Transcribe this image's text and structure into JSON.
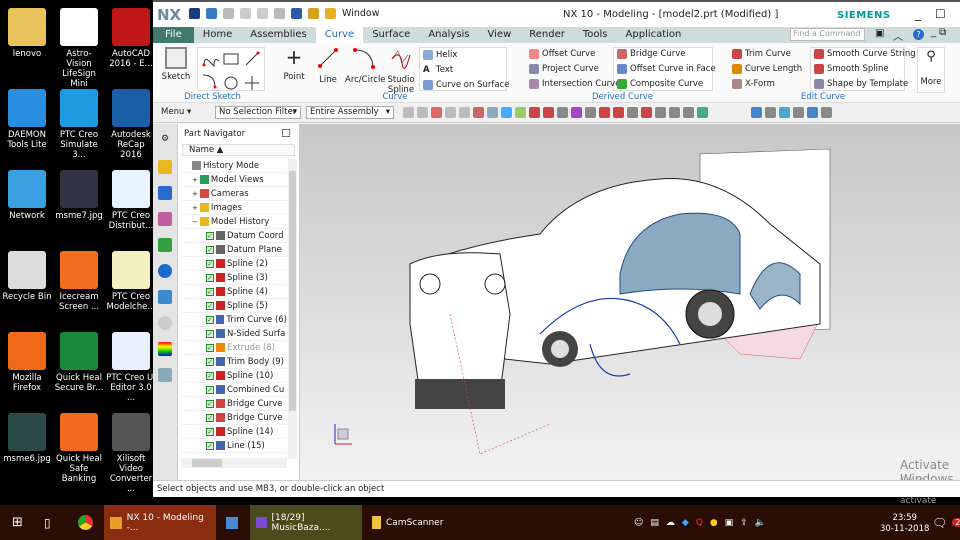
{
  "desktop": {
    "icons": [
      {
        "label": "lenovo",
        "color": "#e8c25a"
      },
      {
        "label": "Astro-Vision LifeSign Mini",
        "color": "#fff"
      },
      {
        "label": "AutoCAD 2016 - E...",
        "color": "#c01818"
      },
      {
        "label": "DAEMON Tools Lite",
        "color": "#2a8ee0"
      },
      {
        "label": "PTC Creo Simulate 3...",
        "color": "#1d9be0"
      },
      {
        "label": "Autodesk ReCap 2016",
        "color": "#1b5ea8"
      },
      {
        "label": "Network",
        "color": "#3aa0e0"
      },
      {
        "label": "msme7.jpg",
        "color": "#334"
      },
      {
        "label": "PTC Creo Distribut...",
        "color": "#e8f4ff"
      },
      {
        "label": "Recycle Bin",
        "color": "#ddd"
      },
      {
        "label": "Icecream Screen ...",
        "color": "#f07020"
      },
      {
        "label": "PTC Creo Modelche...",
        "color": "#f5f0c0"
      },
      {
        "label": "Mozilla Firefox",
        "color": "#f06a1a"
      },
      {
        "label": "Quick Heal Secure Br...",
        "color": "#1a8a3a"
      },
      {
        "label": "PTC Creo UI Editor 3.0 ...",
        "color": "#e8f0ff"
      },
      {
        "label": "msme6.jpg",
        "color": "#2a4a4a"
      },
      {
        "label": "Quick Heal Safe Banking",
        "color": "#f06a20"
      },
      {
        "label": "Xilisoft Video Converter ...",
        "color": "#555"
      }
    ]
  },
  "window": {
    "logo": "NX",
    "quick_access_menu": "Window",
    "title": "NX 10 - Modeling - [model2.prt (Modified) ]",
    "brand": "SIEMENS",
    "brand_color": "#009999"
  },
  "tabs": [
    "File",
    "Home",
    "Assemblies",
    "Curve",
    "Surface",
    "Analysis",
    "View",
    "Render",
    "Tools",
    "Application"
  ],
  "active_tab": "Curve",
  "find_placeholder": "Find a Command",
  "ribbon": {
    "direct_sketch": {
      "label": "Direct Sketch",
      "sketch": "Sketch"
    },
    "curve": {
      "label": "Curve",
      "point": "Point",
      "line": "Line",
      "arc": "Arc/Circle",
      "studio": "Studio Spline",
      "helix": "Helix",
      "text": "Text",
      "cos": "Curve on Surface"
    },
    "derived": {
      "label": "Derived Curve",
      "items": [
        "Offset Curve",
        "Project Curve",
        "Intersection Curve",
        "Bridge Curve",
        "Offset Curve in Face",
        "Composite Curve"
      ]
    },
    "edit": {
      "label": "Edit Curve",
      "items": [
        "Trim Curve",
        "Curve Length",
        "X-Form",
        "Smooth Curve String",
        "Smooth Spline",
        "Shape by Template"
      ]
    },
    "more": "More"
  },
  "cmdbar": {
    "menu": "Menu",
    "filter": "No Selection Filter",
    "scope": "Entire Assembly"
  },
  "navigator": {
    "title": "Part Navigator",
    "column": "Name",
    "items": [
      {
        "label": "History Mode",
        "level": 0,
        "check": false
      },
      {
        "label": "Model Views",
        "level": 0,
        "check": false
      },
      {
        "label": "Cameras",
        "level": 0,
        "check": false
      },
      {
        "label": "Images",
        "level": 0,
        "check": false
      },
      {
        "label": "Model History",
        "level": 0,
        "check": false
      },
      {
        "label": "Datum Coord",
        "level": 1,
        "check": true
      },
      {
        "label": "Datum Plane",
        "level": 1,
        "check": true
      },
      {
        "label": "Spline (2)",
        "level": 1,
        "check": true
      },
      {
        "label": "Spline (3)",
        "level": 1,
        "check": true
      },
      {
        "label": "Spline (4)",
        "level": 1,
        "check": true
      },
      {
        "label": "Spline (5)",
        "level": 1,
        "check": true
      },
      {
        "label": "Trim Curve (6)",
        "level": 1,
        "check": true
      },
      {
        "label": "N-Sided Surfa",
        "level": 1,
        "check": true
      },
      {
        "label": "Extrude (8)",
        "level": 1,
        "check": true
      },
      {
        "label": "Trim Body (9)",
        "level": 1,
        "check": true
      },
      {
        "label": "Spline (10)",
        "level": 1,
        "check": true
      },
      {
        "label": "Combined Cu",
        "level": 1,
        "check": true
      },
      {
        "label": "Bridge Curve",
        "level": 1,
        "check": true
      },
      {
        "label": "Bridge Curve",
        "level": 1,
        "check": true
      },
      {
        "label": "Spline (14)",
        "level": 1,
        "check": true
      },
      {
        "label": "Line (15)",
        "level": 1,
        "check": true
      }
    ]
  },
  "status": "Select objects and use MB3, or double-click an object",
  "watermark": {
    "title": "Activate Windows",
    "sub": "Go to Settings to activate Windows."
  },
  "taskbar": {
    "apps": [
      "NX 10 - Modeling -...",
      "[18/29] MusicBaza....",
      "CamScanner"
    ],
    "time": "23:59",
    "date": "30-11-2018",
    "notifications": "2"
  }
}
